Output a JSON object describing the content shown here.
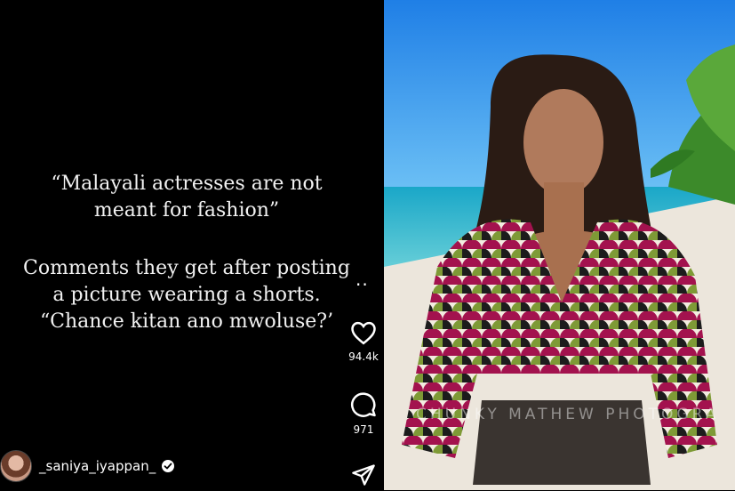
{
  "post": {
    "quote_lines": [
      "“Malayali actresses are not",
      "meant for fashion”"
    ],
    "comment_lines": [
      "Comments they get after posting",
      "a picture wearing a shorts.",
      "“Chance kitan ano mwoluse?’"
    ],
    "username": "_saniya_iyappan_",
    "more_glyph": "..",
    "photo_watermark": "CHUNKY MATHEW PHOTOGRA"
  },
  "actions": {
    "like_icon": "heart-icon",
    "like_count": "94.4k",
    "comment_icon": "comment-bubble-icon",
    "comment_count": "971",
    "share_icon": "paper-plane-icon"
  },
  "colors": {
    "background": "#000000",
    "text": "#f2f2f2",
    "sky": "#2f8ff0",
    "sea": "#2fc6d6",
    "sand": "#efe9e1",
    "top_pink": "#a3124e",
    "top_green": "#7e9a36"
  }
}
